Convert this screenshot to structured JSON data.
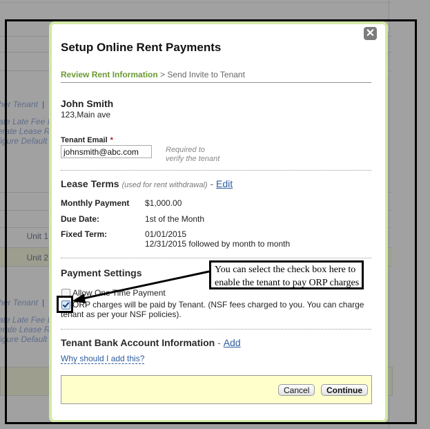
{
  "background": {
    "links_top": [
      "her Tenant",
      "ate Late Fee D",
      "erate Lease R",
      "figure Default"
    ],
    "links_bottom": [
      "her Tenant",
      "ate Late Fee D",
      "erate Lease R",
      "figure Default"
    ],
    "pipe": "|",
    "units": [
      "Unit 1",
      "Unit 2"
    ]
  },
  "modal": {
    "title": "Setup Online Rent Payments",
    "close_icon": "close-icon",
    "breadcrumb": {
      "active": "Review Rent Information",
      "separator": ">",
      "next": "Send Invite to Tenant"
    },
    "tenant": {
      "name": "John Smith",
      "address": "123,Main ave"
    },
    "email": {
      "label": "Tenant Email",
      "required_marker": "*",
      "value": "johnsmith@abc.com",
      "hint_line1": "Required to",
      "hint_line2": "verify the tenant"
    },
    "lease_terms": {
      "heading": "Lease Terms",
      "subheading": "(used for rent withdrawal)",
      "dash": "-",
      "edit_label": "Edit",
      "rows": [
        {
          "label": "Monthly Payment",
          "value": "$1,000.00"
        },
        {
          "label": "Due Date:",
          "value": "1st of the Month"
        },
        {
          "label": "Fixed Term:",
          "value": "01/01/2015",
          "value2": "12/31/2015 followed by month to month"
        }
      ]
    },
    "payment_settings": {
      "heading": "Payment Settings",
      "options": [
        {
          "label": "Allow One Time Payment",
          "checked": false
        },
        {
          "label_line1": "ORP charges will be paid by Tenant. (NSF fees charged to you. You can charge",
          "label_line2": "tenant as per your NSF policies).",
          "checked": true
        }
      ]
    },
    "bank_account": {
      "heading": "Tenant Bank Account Information",
      "dash": "-",
      "add_label": "Add",
      "why_link": "Why should I add this?"
    },
    "footer": {
      "cancel_label": "Cancel",
      "continue_label": "Continue"
    }
  },
  "annotation": {
    "line1": "You can select the check box here to",
    "line2": "enable the tenant to pay ORP charges"
  }
}
